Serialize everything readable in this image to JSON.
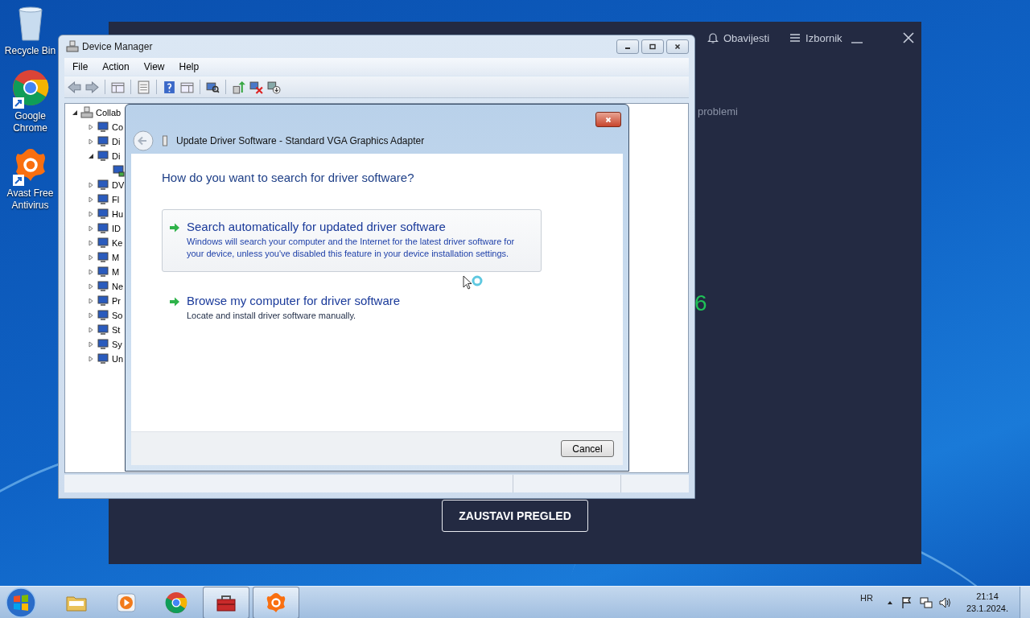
{
  "desktop_icons": [
    {
      "label": "Recycle Bin",
      "kind": "recycle-bin",
      "shortcut": false
    },
    {
      "label": "Google Chrome",
      "kind": "chrome",
      "shortcut": true
    },
    {
      "label": "Avast Free Antivirus",
      "kind": "avast",
      "shortcut": true
    }
  ],
  "avast_window": {
    "notifications": "Obavijesti",
    "menu": "Izbornik",
    "status_text": "problemi",
    "count": "6",
    "stop_button": "ZAUSTAVI PREGLED"
  },
  "device_manager": {
    "title": "Device Manager",
    "menu": [
      "File",
      "Action",
      "View",
      "Help"
    ],
    "tree": {
      "label": "Collab",
      "expanded": true,
      "children": [
        {
          "label": "Co",
          "expanded": false
        },
        {
          "label": "Di",
          "expanded": false
        },
        {
          "label": "Di",
          "expanded": true,
          "children": [
            {
              "kind": "monitor"
            }
          ]
        },
        {
          "label": "DV",
          "expanded": false
        },
        {
          "label": "Fl",
          "expanded": false
        },
        {
          "label": "Hu",
          "expanded": false
        },
        {
          "label": "ID",
          "expanded": false
        },
        {
          "label": "Ke",
          "expanded": false
        },
        {
          "label": "M",
          "expanded": false
        },
        {
          "label": "M",
          "expanded": false
        },
        {
          "label": "Ne",
          "expanded": false
        },
        {
          "label": "Pr",
          "expanded": false
        },
        {
          "label": "So",
          "expanded": false
        },
        {
          "label": "St",
          "expanded": false
        },
        {
          "label": "Sy",
          "expanded": false
        },
        {
          "label": "Un",
          "expanded": false
        }
      ]
    }
  },
  "dialog": {
    "title": "Update Driver Software - Standard VGA Graphics Adapter",
    "heading": "How do you want to search for driver software?",
    "options": [
      {
        "title": "Search automatically for updated driver software",
        "description": "Windows will search your computer and the Internet for the latest driver software for your device, unless you've disabled this feature in your device installation settings.",
        "selected": true
      },
      {
        "title": "Browse my computer for driver software",
        "description": "Locate and install driver software manually.",
        "selected": false
      }
    ],
    "cancel": "Cancel"
  },
  "taskbar": {
    "items": [
      {
        "kind": "explorer",
        "open": false
      },
      {
        "kind": "media-player",
        "open": false
      },
      {
        "kind": "chrome",
        "open": false
      },
      {
        "kind": "device-manager",
        "open": true
      },
      {
        "kind": "avast",
        "open": true
      }
    ],
    "language": "HR",
    "time": "21:14",
    "date": "23.1.2024."
  }
}
